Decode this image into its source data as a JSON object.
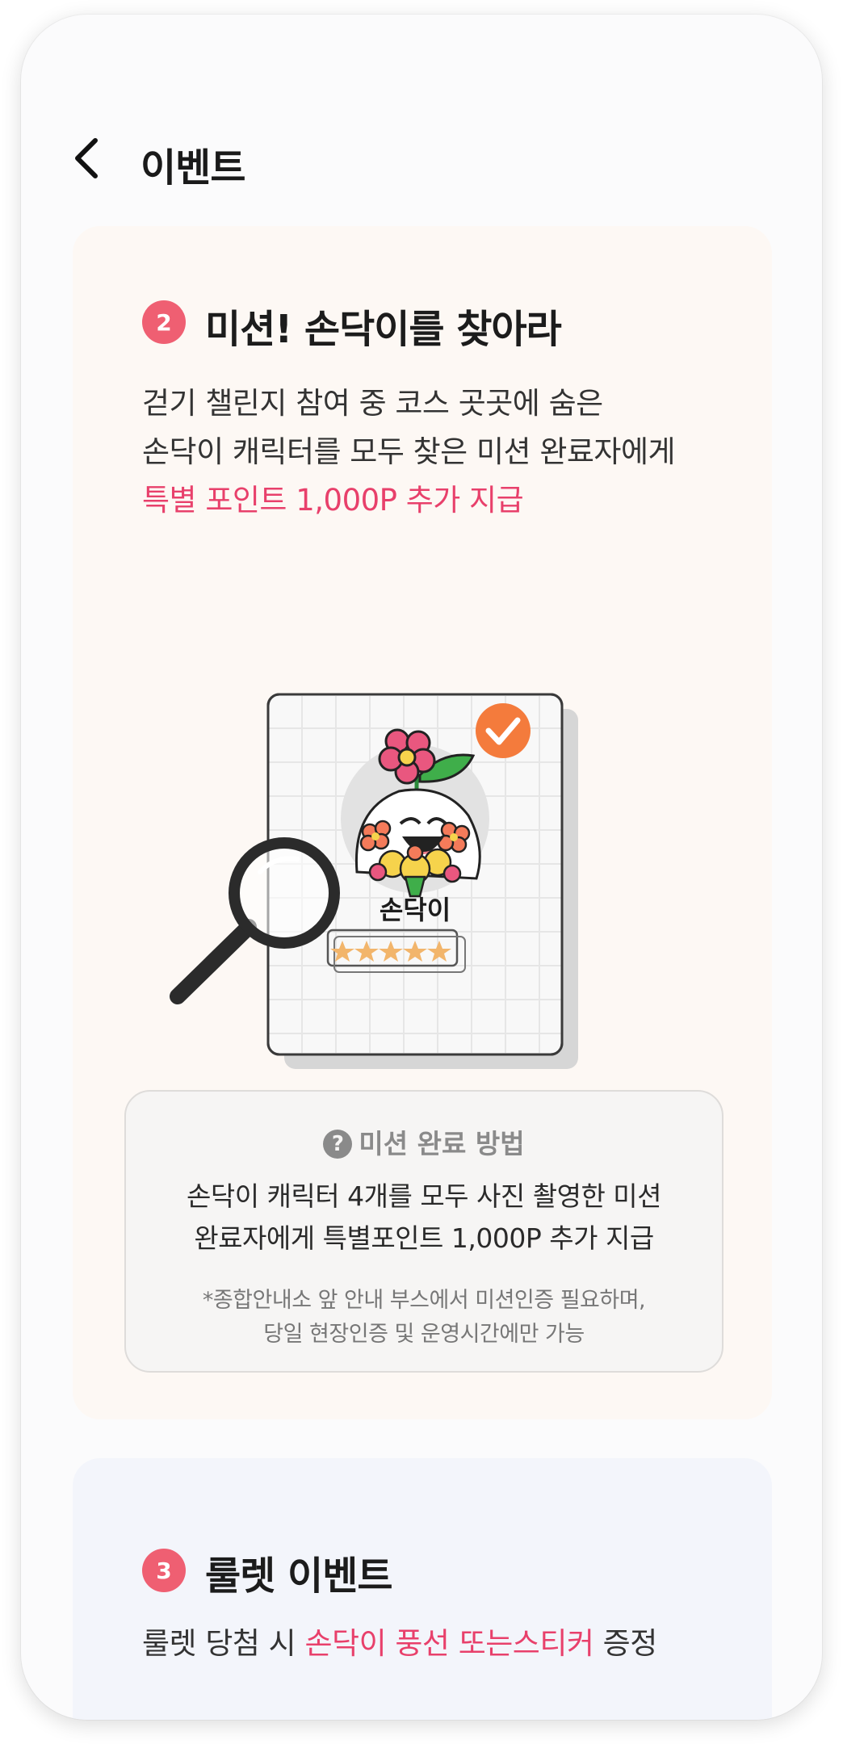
{
  "header": {
    "title": "이벤트"
  },
  "mission": {
    "badge": "2",
    "title": "미션! 손닥이를 찾아라",
    "desc_line1": "걷기 챌린지 참여 중 코스 곳곳에 숨은",
    "desc_line2": "손닥이 캐릭터를 모두 찾은 미션 완료자에게",
    "desc_highlight": "특별 포인트 1,000P 추가 지급",
    "character_name": "손닥이",
    "rating_stars": 5,
    "howto": {
      "title": "미션 완료 방법",
      "body_line1": "손닥이 캐릭터 4개를 모두 사진 촬영한 미션",
      "body_line2": "완료자에게 특별포인트 1,000P 추가 지급",
      "note_line1": "*종합안내소 앞 안내 부스에서 미션인증 필요하며,",
      "note_line2": "당일 현장인증 및 운영시간에만 가능"
    }
  },
  "roulette": {
    "badge": "3",
    "title": "룰렛 이벤트",
    "desc_prefix": "룰렛 당첨 시 ",
    "desc_highlight": "손닥이 풍선 또는스티커",
    "desc_suffix": " 증정"
  },
  "colors": {
    "accent": "#e8406b",
    "badge": "#ef5f72",
    "check": "#f47b3c",
    "mission_bg": "#fdf8f4",
    "roulette_bg": "#f3f5fb"
  },
  "icons": [
    "back-arrow-icon",
    "check-icon",
    "magnifier-icon",
    "question-icon",
    "star-icon"
  ]
}
